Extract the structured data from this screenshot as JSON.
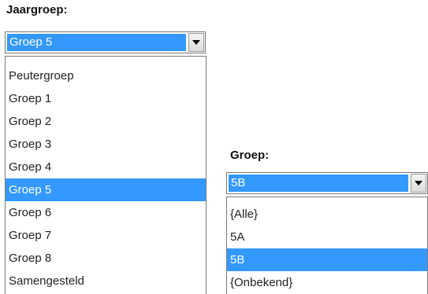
{
  "jaargroep": {
    "label": "Jaargroep:",
    "selected": "Groep 5",
    "options": [
      "Peutergroep",
      "Groep 1",
      "Groep 2",
      "Groep 3",
      "Groep 4",
      "Groep 5",
      "Groep 6",
      "Groep 7",
      "Groep 8",
      "Samengesteld"
    ],
    "selected_index": 5
  },
  "groep": {
    "label": "Groep:",
    "selected": "5B",
    "options": [
      "{Alle}",
      "5A",
      "5B",
      "{Onbekend}"
    ],
    "selected_index": 2
  },
  "colors": {
    "selection": "#3399ff",
    "border": "#7a7a7a"
  },
  "icons": [
    "chevron-down-icon"
  ]
}
